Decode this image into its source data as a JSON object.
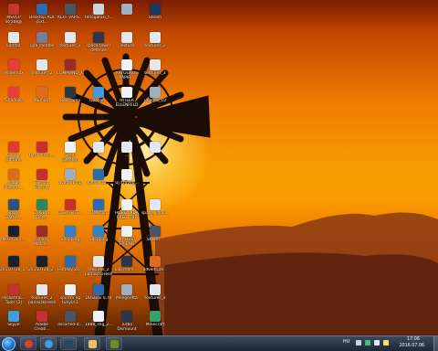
{
  "desktop_icons": [
    {
      "label": "MSVCP Strategy Bo...",
      "color": "#c0392b",
      "col": 0,
      "row": 0
    },
    {
      "label": "Desktop ADL (Ext...",
      "color": "#2b6cb0",
      "col": 1,
      "row": 0
    },
    {
      "label": "KEFF VARS...",
      "color": "#4a5568",
      "col": 2,
      "row": 0
    },
    {
      "label": "felfogatasi_f...",
      "color": "#cbd5e0",
      "col": 3,
      "row": 0
    },
    {
      "label": "",
      "color": "#a0aec0",
      "col": 4,
      "row": 0
    },
    {
      "label": "Steam",
      "color": "#1e3a5f",
      "col": 5,
      "row": 0
    },
    {
      "label": "Lomtár",
      "color": "#e2e8f0",
      "col": 0,
      "row": 1
    },
    {
      "label": "ujra mentés",
      "color": "#718096",
      "col": 1,
      "row": 1
    },
    {
      "label": "textures_2",
      "color": "#e2e8f0",
      "col": 2,
      "row": 1
    },
    {
      "label": "space tower defense",
      "color": "#2d3748",
      "col": 3,
      "row": 1
    },
    {
      "label": "Textúra",
      "color": "#e2e8f0",
      "col": 4,
      "row": 1
    },
    {
      "label": "textures_2",
      "color": "#e2e8f0",
      "col": 5,
      "row": 1
    },
    {
      "label": "Avidemux",
      "color": "#e53e3e",
      "col": 0,
      "row": 2
    },
    {
      "label": "textures_2",
      "color": "#e2e8f0",
      "col": 1,
      "row": 2
    },
    {
      "label": "COMMAND_X...",
      "color": "#9b2c2c",
      "col": 2,
      "row": 2
    },
    {
      "label": "KATOLIKUS PAPIR...",
      "color": "#edf2f7",
      "col": 4,
      "row": 2
    },
    {
      "label": "textures_3",
      "color": "#e2e8f0",
      "col": 5,
      "row": 2
    },
    {
      "label": "fShadows",
      "color": "#e53e3e",
      "col": 0,
      "row": 3
    },
    {
      "label": "MEmuUI",
      "color": "#dd6b20",
      "col": 1,
      "row": 3
    },
    {
      "label": "Bootcamp",
      "color": "#2d3748",
      "col": 2,
      "row": 3
    },
    {
      "label": "Google...",
      "color": "#4299e1",
      "col": 3,
      "row": 3
    },
    {
      "label": "HITLER ELLENFELD",
      "color": "#edf2f7",
      "col": 4,
      "row": 3
    },
    {
      "label": "images_10",
      "color": "#a0aec0",
      "col": 5,
      "row": 3
    },
    {
      "label": "Google Chrome",
      "color": "#dd3f2f",
      "col": 0,
      "row": 4
    },
    {
      "label": "Nitro Pro 9 ...",
      "color": "#c53030",
      "col": 1,
      "row": 4
    },
    {
      "label": "Eredi Gerefen Kaland...",
      "color": "#edf2f7",
      "col": 2,
      "row": 4
    },
    {
      "label": "...",
      "color": "#e2e8f0",
      "col": 3,
      "row": 4
    },
    {
      "label": "...",
      "color": "#e2e8f0",
      "col": 4,
      "row": 4
    },
    {
      "label": "...",
      "color": "#e2e8f0",
      "col": 5,
      "row": 4
    },
    {
      "label": "Adobe Illustrat...",
      "color": "#dd6b20",
      "col": 0,
      "row": 5
    },
    {
      "label": "Format Factory",
      "color": "#c53030",
      "col": 1,
      "row": 5
    },
    {
      "label": "avatar.bmp",
      "color": "#a0aec0",
      "col": 2,
      "row": 5
    },
    {
      "label": "Kanál szó...",
      "color": "#2b6cb0",
      "col": 3,
      "row": 5
    },
    {
      "label": "Új szöveg...",
      "color": "#edf2f7",
      "col": 4,
      "row": 5
    },
    {
      "label": "Space Battle...",
      "color": "#2c5282",
      "col": 0,
      "row": 6
    },
    {
      "label": "DOSBox Tools...",
      "color": "#2f855a",
      "col": 1,
      "row": 6
    },
    {
      "label": "CREATEGS...",
      "color": "#c53030",
      "col": 2,
      "row": 6
    },
    {
      "label": "Desktop",
      "color": "#2b6cb0",
      "col": 3,
      "row": 6
    },
    {
      "label": "HOBBY ADK FREE TRIP",
      "color": "#edf2f7",
      "col": 4,
      "row": 6
    },
    {
      "label": "space_kalau...",
      "color": "#e2e8f0",
      "col": 5,
      "row": 6
    },
    {
      "label": "MP3 Gain...",
      "color": "#1a202c",
      "col": 0,
      "row": 7
    },
    {
      "label": "Galaxy Marco...",
      "color": "#9b2c2c",
      "col": 1,
      "row": 7
    },
    {
      "label": "Shopping",
      "color": "#3182ce",
      "col": 2,
      "row": 7
    },
    {
      "label": "Shopping",
      "color": "#3182ce",
      "col": 3,
      "row": 7
    },
    {
      "label": "MY BEST FRIEND",
      "color": "#edf2f7",
      "col": 4,
      "row": 7
    },
    {
      "label": "Steam...",
      "color": "#4a5568",
      "col": 5,
      "row": 7
    },
    {
      "label": "20150728_1...",
      "color": "#1a202c",
      "col": 0,
      "row": 8
    },
    {
      "label": "20150728_2...",
      "color": "#1a202c",
      "col": 1,
      "row": 8
    },
    {
      "label": "Fantasy Zo...",
      "color": "#2b6cb0",
      "col": 2,
      "row": 8
    },
    {
      "label": "textures_2 panaszkeresés",
      "color": "#e2e8f0",
      "col": 3,
      "row": 8
    },
    {
      "label": "kab mom ...",
      "color": "#2d3748",
      "col": 4,
      "row": 8
    },
    {
      "label": "adventure...",
      "color": "#dd6b20",
      "col": 5,
      "row": 8
    },
    {
      "label": "Pocketmo... Tools (2)",
      "color": "#c53030",
      "col": 0,
      "row": 9
    },
    {
      "label": "textures_2 panaszkeresé",
      "color": "#e2e8f0",
      "col": 1,
      "row": 9
    },
    {
      "label": "spiritm ég tunyia 1",
      "color": "#edf2f7",
      "col": 2,
      "row": 9
    },
    {
      "label": "DOSBox 0.74",
      "color": "#2b6cb0",
      "col": 3,
      "row": 9
    },
    {
      "label": "Menghetta",
      "color": "#a0aec0",
      "col": 4,
      "row": 9
    },
    {
      "label": "textures_4",
      "color": "#e2e8f0",
      "col": 5,
      "row": 9
    },
    {
      "label": "Skype",
      "color": "#3ea0dc",
      "col": 0,
      "row": 10
    },
    {
      "label": "Adobe Creati...",
      "color": "#c53030",
      "col": 1,
      "row": 10
    },
    {
      "label": "assorted-d...",
      "color": "#4a5568",
      "col": 2,
      "row": 10
    },
    {
      "label": "1888_shg_2...",
      "color": "#edf2f7",
      "col": 3,
      "row": 10
    },
    {
      "label": "Turbo Dismount",
      "color": "#2d3748",
      "col": 4,
      "row": 10
    },
    {
      "label": "Minecraft",
      "color": "#38a169",
      "col": 5,
      "row": 10
    }
  ],
  "taskbar": {
    "pinned": [
      {
        "name": "start-orb"
      },
      {
        "name": "chrome-taskbar-button",
        "color": "#dd3f2f"
      },
      {
        "name": "skype-taskbar-button",
        "color": "#3ea0dc"
      },
      {
        "name": "steam-taskbar-button",
        "color": "#2a475e"
      },
      {
        "name": "explorer-taskbar-button",
        "color": "#e8c36a"
      },
      {
        "name": "minecraft-taskbar-button",
        "color": "#6b8e23"
      }
    ],
    "language": "HU",
    "time": "17:06",
    "date": "2016.07.06."
  }
}
